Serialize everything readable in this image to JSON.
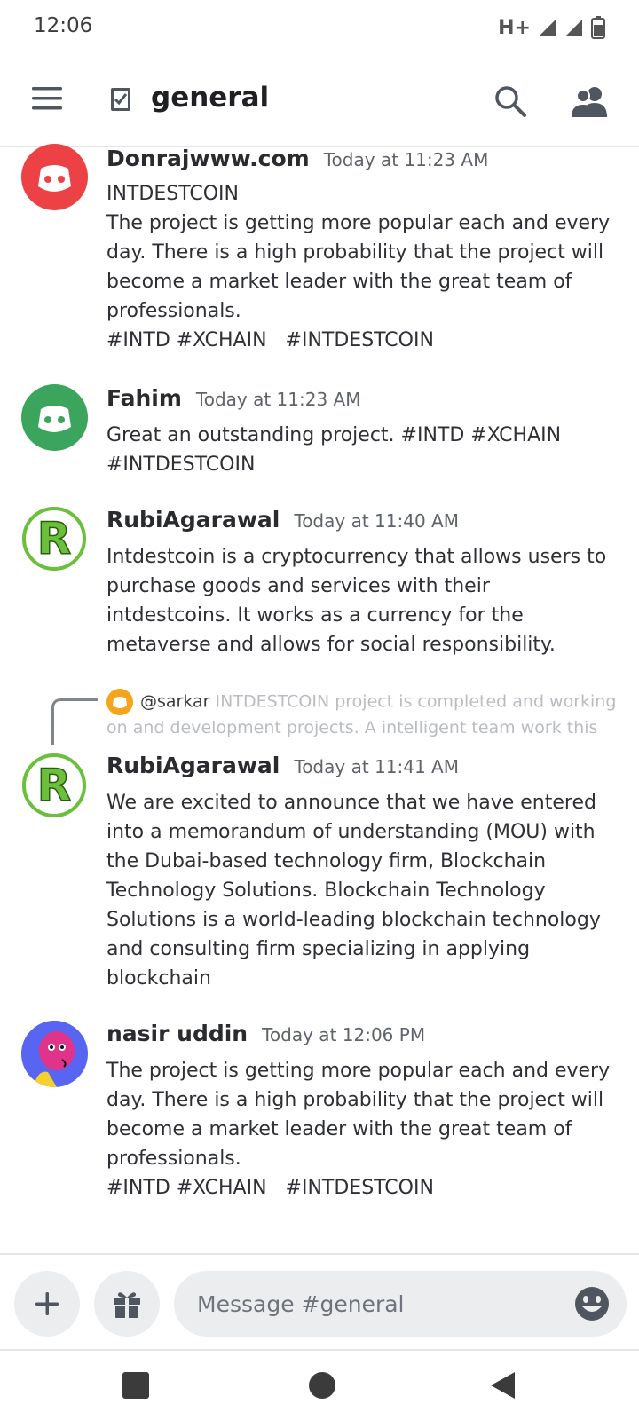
{
  "status_bar": {
    "time": "12:06",
    "network": "H+"
  },
  "header": {
    "channel_name": "general"
  },
  "messages": [
    {
      "author": "Donrajwww.com",
      "time": "Today at 11:23 AM",
      "avatar_color": "#ed4245",
      "avatar_icon": "discord-logo",
      "body": "INTDESTCOIN\nThe project is getting more popular each and every day. There is a high probability that the project will become a market leader with the great team of professionals.\n#INTD #XCHAIN   #INTDESTCOIN"
    },
    {
      "author": "Fahim",
      "time": "Today at 11:23 AM",
      "avatar_color": "#3ba55d",
      "avatar_icon": "discord-logo",
      "body": "Great an outstanding project. #INTD #XCHAIN\n#INTDESTCOIN"
    },
    {
      "author": "RubiAgarawal",
      "time": "Today at 11:40 AM",
      "avatar_color": "#6abf3b",
      "avatar_icon": "letter-r-logo",
      "body": "Intdestcoin is a cryptocurrency that allows users to purchase goods and services with their intdestcoins. It works as a currency for the metaverse and allows for social responsibility."
    },
    {
      "author": "RubiAgarawal",
      "time": "Today at 11:41 AM",
      "avatar_color": "#6abf3b",
      "avatar_icon": "letter-r-logo",
      "reply": {
        "user": "@sarkar",
        "text": "INTDESTCOIN project is completed and working on and development projects. A intelligent team work this"
      },
      "body": "We are excited to announce that we have entered into a memorandum of understanding (MOU) with the Dubai-based technology firm, Blockchain Technology Solutions. Blockchain Technology Solutions is a world-leading blockchain technology and consulting firm specializing in applying blockchain"
    },
    {
      "author": "nasir uddin",
      "time": "Today at 12:06 PM",
      "avatar_color": "#5865f2",
      "avatar_icon": "cartoon-avatar",
      "body": "The project is getting more popular each and every day. There is a high probability that the project will become a market leader with the great team of professionals.\n#INTD #XCHAIN   #INTDESTCOIN"
    }
  ],
  "composer": {
    "placeholder": "Message #general"
  }
}
